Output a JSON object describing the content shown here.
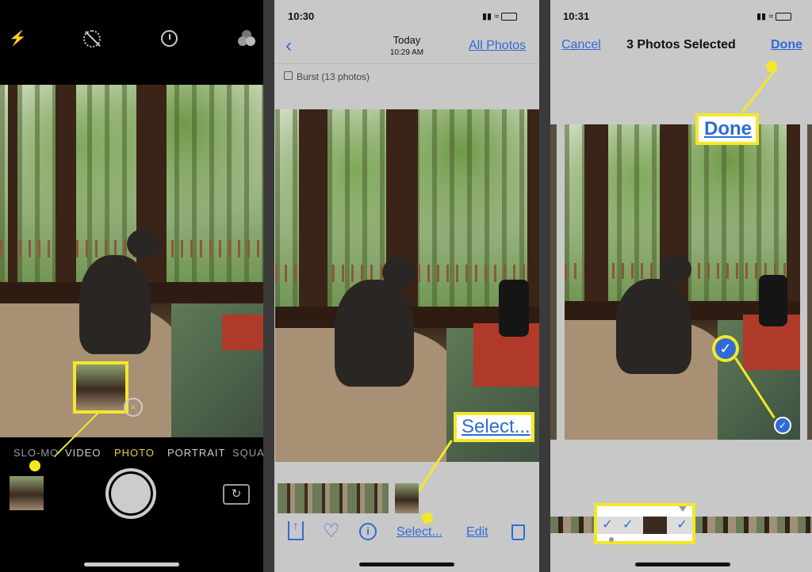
{
  "camera": {
    "modes": [
      "SLO-MO",
      "VIDEO",
      "PHOTO",
      "PORTRAIT",
      "SQUARE"
    ],
    "active_mode": "PHOTO",
    "icons": [
      "flash-icon",
      "live-photo-off-icon",
      "timer-icon",
      "filters-icon",
      "camera-flip-icon"
    ],
    "accent_color": "#e6d04a"
  },
  "burst": {
    "status_time": "10:30",
    "nav_title": "Today",
    "nav_subtitle": "10:29 AM",
    "all_photos": "All Photos",
    "burst_label": "Burst (13 photos)",
    "toolbar": {
      "select": "Select...",
      "edit": "Edit"
    },
    "callout_label": "Select..."
  },
  "select": {
    "status_time": "10:31",
    "cancel": "Cancel",
    "title": "3 Photos Selected",
    "done": "Done",
    "callout_label": "Done",
    "selected_count": 3
  },
  "colors": {
    "callout": "#f2e829",
    "link": "#2f6bd6"
  }
}
